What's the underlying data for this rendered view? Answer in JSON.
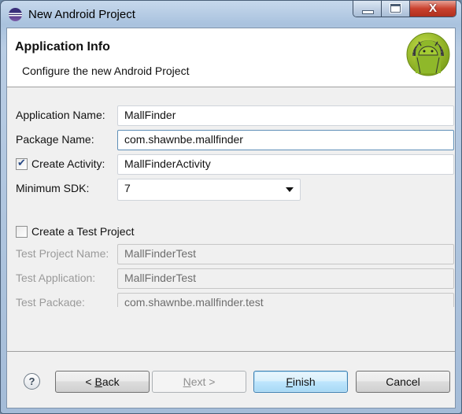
{
  "window": {
    "title": "New Android Project",
    "controls": {
      "minimize": "minimize",
      "maximize": "maximize",
      "close": "X"
    }
  },
  "header": {
    "title": "Application Info",
    "description": "Configure the new Android Project",
    "logo_icon": "android-logo-icon"
  },
  "form": {
    "application_name": {
      "label": "Application Name:",
      "value": "MallFinder"
    },
    "package_name": {
      "label": "Package Name:",
      "value": "com.shawnbe.mallfinder"
    },
    "create_activity": {
      "label": "Create Activity:",
      "checked": true,
      "value": "MallFinderActivity"
    },
    "minimum_sdk": {
      "label": "Minimum SDK:",
      "value": "7"
    }
  },
  "test_project": {
    "checkbox_label": "Create a Test Project",
    "checked": false,
    "test_project_name": {
      "label": "Test Project Name:",
      "value": "MallFinderTest"
    },
    "test_application": {
      "label": "Test Application:",
      "value": "MallFinderTest"
    },
    "test_package": {
      "label": "Test Package:",
      "value": "com.shawnbe.mallfinder.test"
    }
  },
  "footer": {
    "help_icon": "?",
    "back_prefix": "< ",
    "back_mnemonic": "B",
    "back_rest": "ack",
    "next_mnemonic": "N",
    "next_rest": "ext >",
    "finish_mnemonic": "F",
    "finish_rest": "inish",
    "cancel": "Cancel"
  }
}
